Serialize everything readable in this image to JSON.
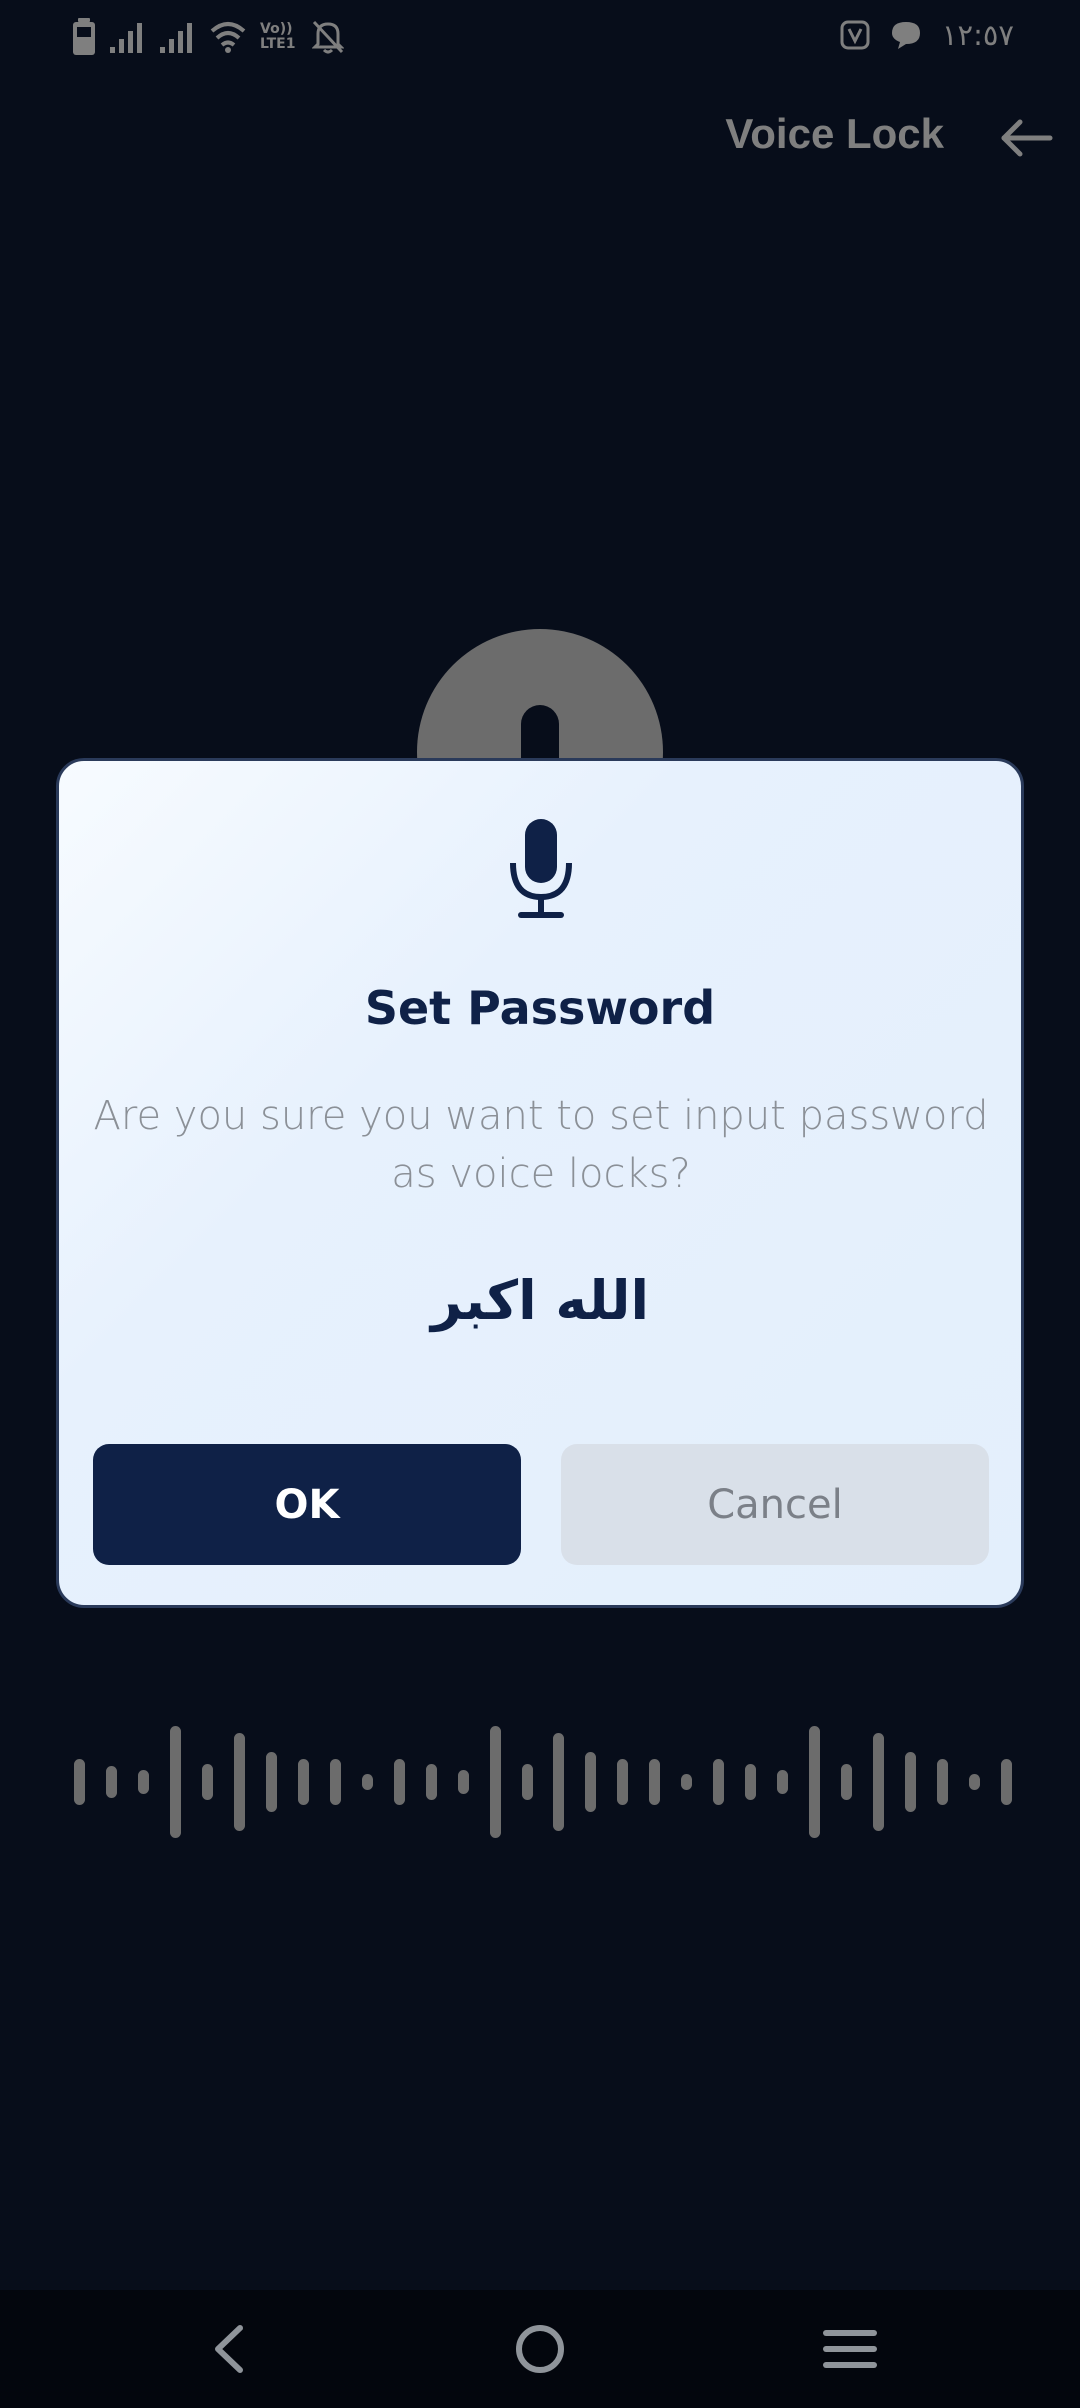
{
  "status_bar": {
    "time": "١٢:٥٧",
    "left_icons": [
      "battery-icon",
      "signal-icon",
      "signal-icon",
      "wifi-icon",
      "volte-icon",
      "mute-icon"
    ],
    "volte_label": "Vo)) LTE1",
    "right_icons": [
      "nfc-icon",
      "chat-icon"
    ]
  },
  "header": {
    "title": "Voice Lock"
  },
  "dialog": {
    "title": "Set Password",
    "message": "Are you sure you want to set input password as voice locks?",
    "password": "الله اکبر",
    "ok_label": "OK",
    "cancel_label": "Cancel"
  },
  "waveform": {
    "levels": [
      0.28,
      0.2,
      0.15,
      0.68,
      0.22,
      0.6,
      0.36,
      0.28,
      0.28,
      0.1,
      0.28,
      0.22,
      0.15,
      0.68,
      0.22,
      0.6,
      0.36,
      0.28,
      0.28,
      0.1,
      0.28,
      0.22,
      0.15,
      0.68,
      0.22,
      0.6,
      0.36,
      0.28,
      0.1,
      0.28
    ]
  },
  "nav_bar": {
    "buttons": [
      "back-icon",
      "home-icon",
      "recents-icon"
    ]
  },
  "colors": {
    "background": "#0f1a34",
    "primary": "#0f2147",
    "cancel_bg": "#d9e0e9",
    "muted_text": "#8b9097"
  }
}
